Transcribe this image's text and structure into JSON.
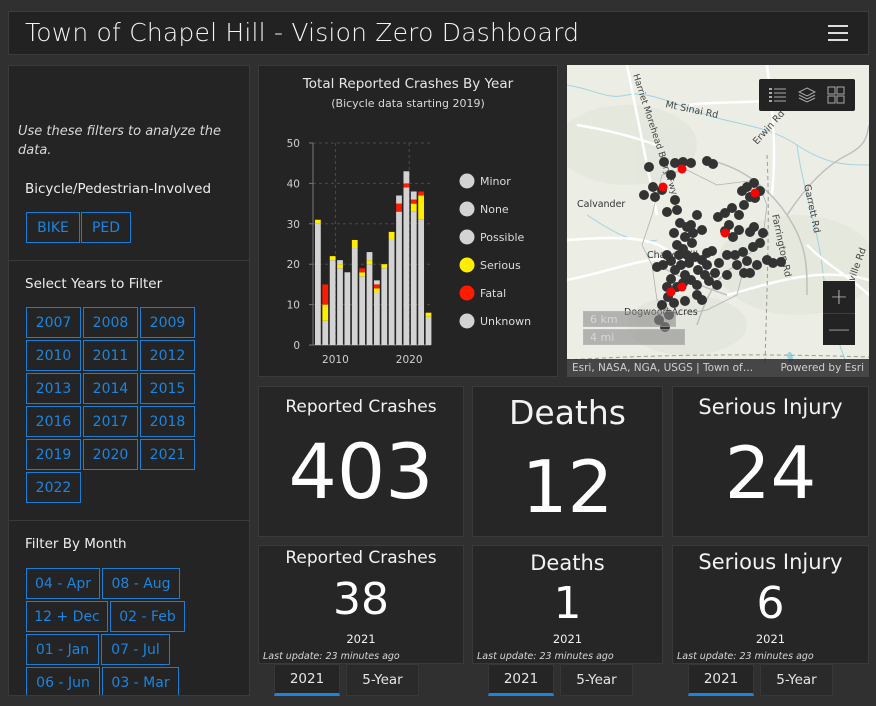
{
  "header": {
    "title": "Town of Chapel Hill - Vision Zero Dashboard",
    "menu_icon": "hamburger-menu-icon"
  },
  "sidebar": {
    "intro": "Use these filters to analyze the data.",
    "mode_heading": "Bicycle/Pedestrian-Involved",
    "mode_buttons": [
      "BIKE",
      "PED"
    ],
    "years_heading": "Select Years to Filter",
    "year_buttons": [
      "2007",
      "2008",
      "2009",
      "2010",
      "2011",
      "2012",
      "2013",
      "2014",
      "2015",
      "2016",
      "2017",
      "2018",
      "2019",
      "2020",
      "2021",
      "2022"
    ],
    "month_heading": "Filter By Month",
    "month_buttons": [
      [
        "04 - Apr",
        "08 - Aug"
      ],
      [
        "12 + Dec",
        "02 - Feb"
      ],
      [
        "01 - Jan",
        "07 - Jul"
      ],
      [
        "06 - Jun",
        "03 - Mar"
      ]
    ]
  },
  "chart_data": {
    "type": "bar",
    "stacked": true,
    "title": "Total Reported Crashes By Year",
    "subtitle": "(Bicycle data starting 2019)",
    "xlabel": "",
    "ylabel": "",
    "ylim": [
      0,
      50
    ],
    "yticks": [
      0,
      10,
      20,
      30,
      40,
      50
    ],
    "xticks": [
      "2010",
      "2020"
    ],
    "grid": true,
    "legend_position": "right",
    "legend": [
      {
        "label": "Minor",
        "color": "#d3d3d3"
      },
      {
        "label": "None",
        "color": "#d3d3d3"
      },
      {
        "label": "Possible",
        "color": "#d3d3d3"
      },
      {
        "label": "Serious",
        "color": "#ffee00"
      },
      {
        "label": "Fatal",
        "color": "#ff1a00"
      },
      {
        "label": "Unknown",
        "color": "#d3d3d3"
      }
    ],
    "categories": [
      "2007",
      "2008",
      "2009",
      "2010",
      "2011",
      "2012",
      "2013",
      "2014",
      "2015",
      "2016",
      "2017",
      "2018",
      "2019",
      "2020",
      "2021",
      "2022"
    ],
    "series": [
      {
        "name": "Other (Minor/None/Possible)",
        "color": "#d3d3d3",
        "values": [
          30,
          6,
          21,
          19,
          18,
          24,
          17,
          20,
          13,
          19,
          26,
          33,
          39,
          33,
          31,
          7
        ]
      },
      {
        "name": "Serious",
        "color": "#ffee00",
        "values": [
          1,
          4,
          1,
          1,
          0,
          2,
          1,
          1,
          1,
          1,
          2,
          0,
          0,
          2,
          6,
          1
        ]
      },
      {
        "name": "Fatal",
        "color": "#ff1a00",
        "values": [
          0,
          5,
          0,
          0,
          0,
          0,
          1,
          0,
          1,
          0,
          0,
          2,
          1,
          1,
          1,
          0
        ]
      },
      {
        "name": "Unknown",
        "color": "#d3d3d3",
        "values": [
          0,
          0,
          0,
          1,
          0,
          0,
          0,
          2,
          1,
          0,
          0,
          2,
          3,
          2,
          0,
          0
        ]
      }
    ],
    "totals": [
      31,
      15,
      22,
      21,
      18,
      26,
      19,
      23,
      16,
      20,
      28,
      37,
      43,
      38,
      38,
      8
    ]
  },
  "map": {
    "labels": [
      "Mt Sinai Rd",
      "Harriet Morehead Berry Fwy",
      "Erwin Rd",
      "Calvander",
      "Chapel Hill",
      "Garrett Rd",
      "Farrington Rd",
      "Dogwood Acres",
      "Fayetteville Rd"
    ],
    "toolbar": [
      "legend-icon",
      "layers-icon",
      "basemap-gallery-icon"
    ],
    "zoom_in": "+",
    "zoom_out": "—",
    "scale_km": "6 km",
    "scale_mi": "4 mi",
    "attribution": "Esri, NASA, NGA, USGS | Town of…",
    "powered_by": "Powered by Esri",
    "point_colors": {
      "crash": "#333333",
      "fatal": "#ff0000"
    }
  },
  "kpis_total": [
    {
      "label": "Reported Crashes",
      "value": "403"
    },
    {
      "label": "Deaths",
      "value": "12"
    },
    {
      "label": "Serious Injury",
      "value": "24"
    }
  ],
  "kpis_year": [
    {
      "label": "Reported Crashes",
      "value": "38",
      "year": "2021",
      "updated": "Last update: 23 minutes ago",
      "tabs": [
        "2021",
        "5-Year"
      ],
      "active_tab": "2021"
    },
    {
      "label": "Deaths",
      "value": "1",
      "year": "2021",
      "updated": "Last update: 23 minutes ago",
      "tabs": [
        "2021",
        "5-Year"
      ],
      "active_tab": "2021"
    },
    {
      "label": "Serious Injury",
      "value": "6",
      "year": "2021",
      "updated": "Last update: 23 minutes ago",
      "tabs": [
        "2021",
        "5-Year"
      ],
      "active_tab": "2021"
    }
  ],
  "colors": {
    "accent": "#1a85e0",
    "background": "#303030",
    "panel": "#242424"
  }
}
